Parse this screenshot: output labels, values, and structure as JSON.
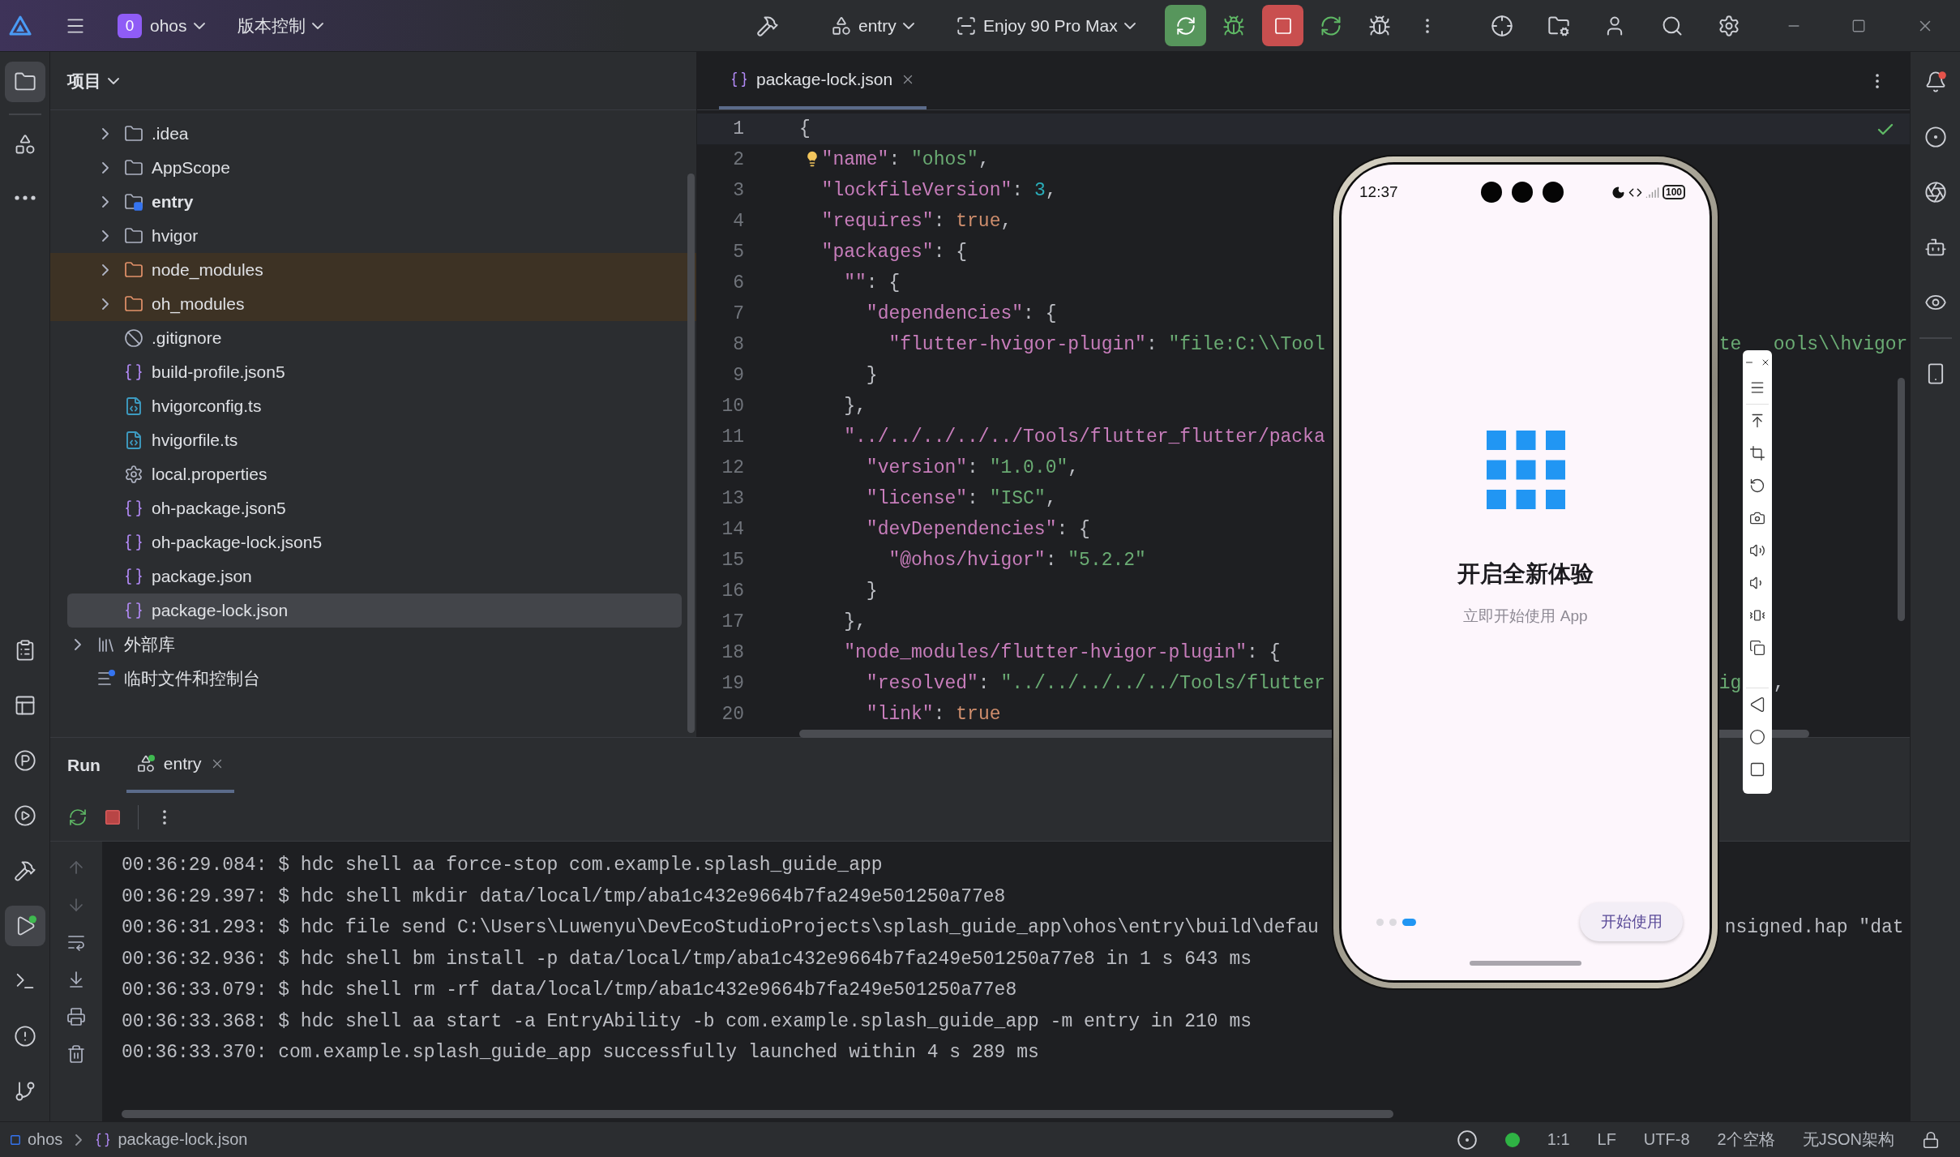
{
  "title_bar": {
    "project_badge": "0",
    "project": "ohos",
    "vcs": "版本控制",
    "run_config": "entry",
    "device": "Enjoy 90 Pro Max"
  },
  "left_toolbar": {
    "top": [
      {
        "kind": "project",
        "selected": true
      },
      {
        "kind": "structure",
        "selected": false
      },
      {
        "kind": "more",
        "selected": false
      }
    ],
    "bottom": [
      {
        "kind": "todo",
        "selected": false
      },
      {
        "kind": "layout",
        "selected": false
      },
      {
        "kind": "profiler",
        "selected": false
      },
      {
        "kind": "services",
        "selected": false
      },
      {
        "kind": "build",
        "selected": false
      },
      {
        "kind": "run",
        "selected": true
      },
      {
        "kind": "terminal",
        "selected": false
      },
      {
        "kind": "problems",
        "selected": false
      },
      {
        "kind": "git",
        "selected": false
      }
    ]
  },
  "project_panel": {
    "title": "项目",
    "items": [
      {
        "label": ".idea",
        "kind": "folder",
        "expandable": true,
        "selected": false
      },
      {
        "label": "AppScope",
        "kind": "folder",
        "expandable": true,
        "selected": false
      },
      {
        "label": "entry",
        "kind": "module",
        "expandable": true,
        "selected": false
      },
      {
        "label": "hvigor",
        "kind": "folder",
        "expandable": true,
        "selected": false
      },
      {
        "label": "node_modules",
        "kind": "excluded",
        "expandable": true,
        "selected": false
      },
      {
        "label": "oh_modules",
        "kind": "excluded",
        "expandable": true,
        "selected": false
      },
      {
        "label": ".gitignore",
        "kind": "gitignore",
        "expandable": false,
        "selected": false
      },
      {
        "label": "build-profile.json5",
        "kind": "json",
        "expandable": false,
        "selected": false
      },
      {
        "label": "hvigorconfig.ts",
        "kind": "ts",
        "expandable": false,
        "selected": false
      },
      {
        "label": "hvigorfile.ts",
        "kind": "ts",
        "expandable": false,
        "selected": false
      },
      {
        "label": "local.properties",
        "kind": "properties",
        "expandable": false,
        "selected": false
      },
      {
        "label": "oh-package.json5",
        "kind": "json",
        "expandable": false,
        "selected": false
      },
      {
        "label": "oh-package-lock.json5",
        "kind": "json",
        "expandable": false,
        "selected": false
      },
      {
        "label": "package.json",
        "kind": "json",
        "expandable": false,
        "selected": false
      },
      {
        "label": "package-lock.json",
        "kind": "json",
        "expandable": false,
        "selected": true
      }
    ],
    "roots": [
      {
        "label": "外部库",
        "kind": "library",
        "expandable": true,
        "selected": false
      },
      {
        "label": "临时文件和控制台",
        "kind": "scratch",
        "expandable": false,
        "selected": false
      }
    ]
  },
  "editor": {
    "tabs": [
      {
        "label": "package-lock.json",
        "selected": true
      }
    ],
    "lines": [
      {
        "number": "1",
        "text": "{",
        "current": true
      },
      {
        "number": "2",
        "text": "  \"name\": \"ohos\",",
        "current": false,
        "hint": true
      },
      {
        "number": "3",
        "text": "  \"lockfileVersion\": 3,",
        "current": false
      },
      {
        "number": "4",
        "text": "  \"requires\": true,",
        "current": false
      },
      {
        "number": "5",
        "text": "  \"packages\": {",
        "current": false
      },
      {
        "number": "6",
        "text": "    \"\": {",
        "current": false
      },
      {
        "number": "7",
        "text": "      \"dependencies\": {",
        "current": false
      },
      {
        "number": "8",
        "text": "        \"flutter-hvigor-plugin\": \"file:C:\\\\Tool",
        "current": false,
        "right_of_phone": "te",
        "right_of_toolbar": "ools\\\\hvigor"
      },
      {
        "number": "9",
        "text": "      }",
        "current": false
      },
      {
        "number": "10",
        "text": "    },",
        "current": false
      },
      {
        "number": "11",
        "text": "    \"../../../../../Tools/flutter_flutter/packa",
        "current": false
      },
      {
        "number": "12",
        "text": "      \"version\": \"1.0.0\",",
        "current": false
      },
      {
        "number": "13",
        "text": "      \"license\": \"ISC\",",
        "current": false
      },
      {
        "number": "14",
        "text": "      \"devDependencies\": {",
        "current": false
      },
      {
        "number": "15",
        "text": "        \"@ohos/hvigor\": \"5.2.2\"",
        "current": false
      },
      {
        "number": "16",
        "text": "      }",
        "current": false
      },
      {
        "number": "17",
        "text": "    },",
        "current": false
      },
      {
        "number": "18",
        "text": "    \"node_modules/flutter-hvigor-plugin\": {",
        "current": false
      },
      {
        "number": "19",
        "text": "      \"resolved\": \"../../../../../Tools/flutter",
        "current": false,
        "right_of_phone": "ig",
        "right_of_toolbar": ","
      },
      {
        "number": "20",
        "text": "      \"link\": true",
        "current": false
      }
    ]
  },
  "run_panel": {
    "title": "Run",
    "tabs": [
      {
        "label": "entry",
        "selected": true
      }
    ],
    "lines": [
      {
        "text": "00:36:29.084: $ hdc shell aa force-stop com.example.splash_guide_app"
      },
      {
        "text": "00:36:29.397: $ hdc shell mkdir data/local/tmp/aba1c432e9664b7fa249e501250a77e8"
      },
      {
        "text": "00:36:31.293: $ hdc file send C:\\Users\\Luwenyu\\DevEcoStudioProjects\\splash_guide_app\\ohos\\entry\\build\\defau",
        "right_of_phone": "nsigned.hap \"dat"
      },
      {
        "text": "00:36:32.936: $ hdc shell bm install -p data/local/tmp/aba1c432e9664b7fa249e501250a77e8 in 1 s 643 ms"
      },
      {
        "text": "00:36:33.079: $ hdc shell rm -rf data/local/tmp/aba1c432e9664b7fa249e501250a77e8"
      },
      {
        "text": "00:36:33.368: $ hdc shell aa start -a EntryAbility -b com.example.splash_guide_app -m entry in 210 ms"
      },
      {
        "text": "00:36:33.370: com.example.splash_guide_app successfully launched within 4 s 289 ms"
      }
    ]
  },
  "emulator": {
    "time": "12:37",
    "battery": "100",
    "title": "开启全新体验",
    "subtitle": "立即开始使用 App",
    "pages": [
      {
        "selected": false
      },
      {
        "selected": false
      },
      {
        "selected": true
      }
    ],
    "button": "开始使用",
    "tools": [
      {
        "kind": "menu"
      },
      {
        "kind": "to_top"
      },
      {
        "kind": "crop"
      },
      {
        "kind": "rotate"
      },
      {
        "kind": "screenshot"
      },
      {
        "kind": "volume_up"
      },
      {
        "kind": "volume_down"
      },
      {
        "kind": "shake"
      },
      {
        "kind": "multi_screen"
      },
      {
        "kind": "back"
      },
      {
        "kind": "home"
      },
      {
        "kind": "recent"
      }
    ]
  },
  "right_toolbar": [
    {
      "kind": "notifications",
      "unread": true
    },
    {
      "kind": "assistant",
      "unread": false
    },
    {
      "kind": "aperture",
      "unread": false
    },
    {
      "kind": "bot",
      "unread": false
    },
    {
      "kind": "preview",
      "unread": false
    },
    {
      "kind": "device",
      "unread": false
    }
  ],
  "status_bar": {
    "breadcrumbs": [
      {
        "kind": "module",
        "label": "ohos"
      },
      {
        "kind": "json",
        "label": "package-lock.json"
      }
    ],
    "items": [
      "1:1",
      "LF",
      "UTF-8",
      "2个空格",
      "无JSON架构"
    ]
  }
}
